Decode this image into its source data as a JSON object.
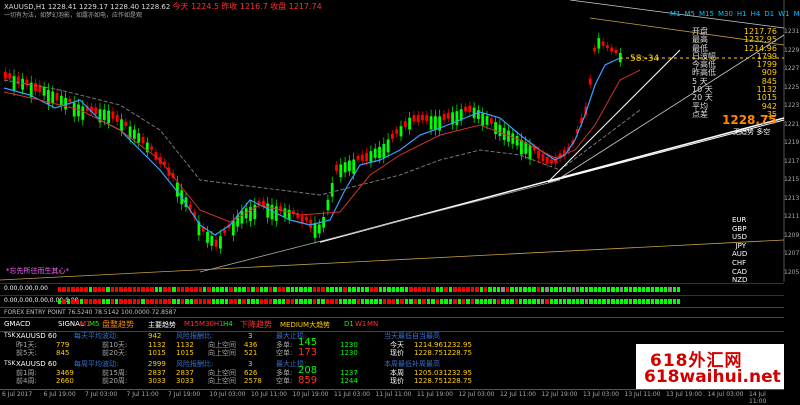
{
  "header": {
    "symbol_info": "XAUUSD,H1  1228.41 1229.17 1228.40 1228.62",
    "prices": [
      "今天 1224.5",
      "昨收 1216.7",
      "收盘 1217.74"
    ],
    "subtitle": "一切有为法，如梦幻泡影，如露亦如电，应作如是观"
  },
  "timeframes": [
    "M1",
    "M5",
    "M15",
    "M30",
    "H1",
    "H4",
    "D1",
    "W1",
    "MN"
  ],
  "price_tag": "58:-34",
  "stats_panel": [
    {
      "label": "开盘",
      "value": "1217.76"
    },
    {
      "label": "最高",
      "value": "1232.95"
    },
    {
      "label": "最低",
      "value": "1214.96"
    },
    {
      "label": "日波幅",
      "value": "1799"
    },
    {
      "label": "今高低",
      "value": "1799"
    },
    {
      "label": "昨高低",
      "value": "909"
    },
    {
      "label": "5  天",
      "value": "845"
    },
    {
      "label": "10 天",
      "value": "1132"
    },
    {
      "label": "20 天",
      "value": "1015"
    },
    {
      "label": "平均",
      "value": "942"
    },
    {
      "label": "点差",
      "value": "35"
    }
  ],
  "big_price": "1228.75",
  "trend_text": "无趋势  多空",
  "currencies": [
    "EUR",
    "GBP",
    "USD",
    "JPY",
    "AUD",
    "CHF",
    "CAD",
    "NZD"
  ],
  "y_axis_labels": [
    "1231",
    "1229",
    "1227",
    "1225",
    "1223",
    "1221",
    "1219",
    "1217",
    "1215",
    "1213",
    "1211",
    "1209",
    "1207",
    "1205"
  ],
  "note": "*忘先所往而生其心*",
  "indicator_rows": [
    {
      "label": "0.00,0.00,0.00"
    },
    {
      "label": "0.00,0.00,0.00,0.00,0.00"
    }
  ],
  "forex_entry": "FOREX ENTRY POINT 76.5240 78.5142 100.0000 72.8587",
  "gmacd": {
    "label": "GMACD",
    "signal": "SIGNAL",
    "m1": "M1",
    "m5": "M5",
    "trend1": "盘整趋势",
    "trend2": "主要趋势",
    "mtf": "M15M30H1",
    "h4": "H4",
    "trend3": "下降趋势",
    "medium": "MEDIUM大趋势",
    "d1": "D1",
    "w1": "W1",
    "mn": "MN"
  },
  "table1": {
    "title": "XAUUSD 60",
    "row_label_a": "昨1天:",
    "row_label_b": "前5天:",
    "v1": "779",
    "v2": "845",
    "avg_label": "每天平均波动:",
    "avg_val": "942",
    "sub_a": "前10天:",
    "sub_b": "前20天:",
    "sv1": "1132",
    "sv2": "1015",
    "risk": "风险报酬比:",
    "risk_val": "3",
    "ra": "1132",
    "rb": "1015",
    "up": "向上空间",
    "up_v1": "436",
    "up_v2": "521",
    "stop": "最大止损:",
    "buy": "多单:",
    "buy_v": "145",
    "sell": "空单:",
    "sell_v": "173",
    "buy_r": "1230",
    "sell_r": "1230",
    "today_high": "当天最低自当最高",
    "today": "今天",
    "today_v": "1214.961232.95",
    "now": "现价",
    "now_v": "1228.751228.75"
  },
  "table2": {
    "title": "XAUUSD 60",
    "row_label_a": "前1周:",
    "row_label_b": "前4周:",
    "v1": "3469",
    "v2": "2660",
    "avg_label": "每周平均波动:",
    "avg_val": "2999",
    "sub_a": "前15周:",
    "sub_b": "前20周:",
    "sv1": "2837",
    "sv2": "3033",
    "risk": "风险报酬比:",
    "risk_val": "3",
    "up": "向上空间",
    "up_v1": "626",
    "up_v2": "2578",
    "stop": "最大止损:",
    "buy": "多单:",
    "buy_v": "208",
    "sell": "空单:",
    "sell_v": "859",
    "buy_r": "1237",
    "sell_r": "1244",
    "week_high": "本周最低补周最高",
    "week": "本周",
    "week_v": "1205.031232.95",
    "now": "现价",
    "now_v": "1228.751228.75"
  },
  "x_axis": [
    "6 Jul 2017",
    "6 Jul 19:00",
    "7 Jul 03:00",
    "7 Jul 11:00",
    "7 Jul 19:00",
    "10 Jul 03:00",
    "10 Jul 11:00",
    "10 Jul 19:00",
    "11 Jul 03:00",
    "11 Jul 11:00",
    "11 Jul 19:00",
    "12 Jul 03:00",
    "12 Jul 11:00",
    "12 Jul 19:00",
    "13 Jul 03:00",
    "13 Jul 11:00",
    "13 Jul 19:00",
    "14 Jul 03:00",
    "14 Jul 11:00"
  ],
  "watermark": {
    "line1": "618外汇网",
    "line2": "618waihui.net"
  },
  "colors": {
    "bull": "#00ff00",
    "bear": "#ff0000",
    "bg": "#000000",
    "accent": "#ffcc00"
  }
}
